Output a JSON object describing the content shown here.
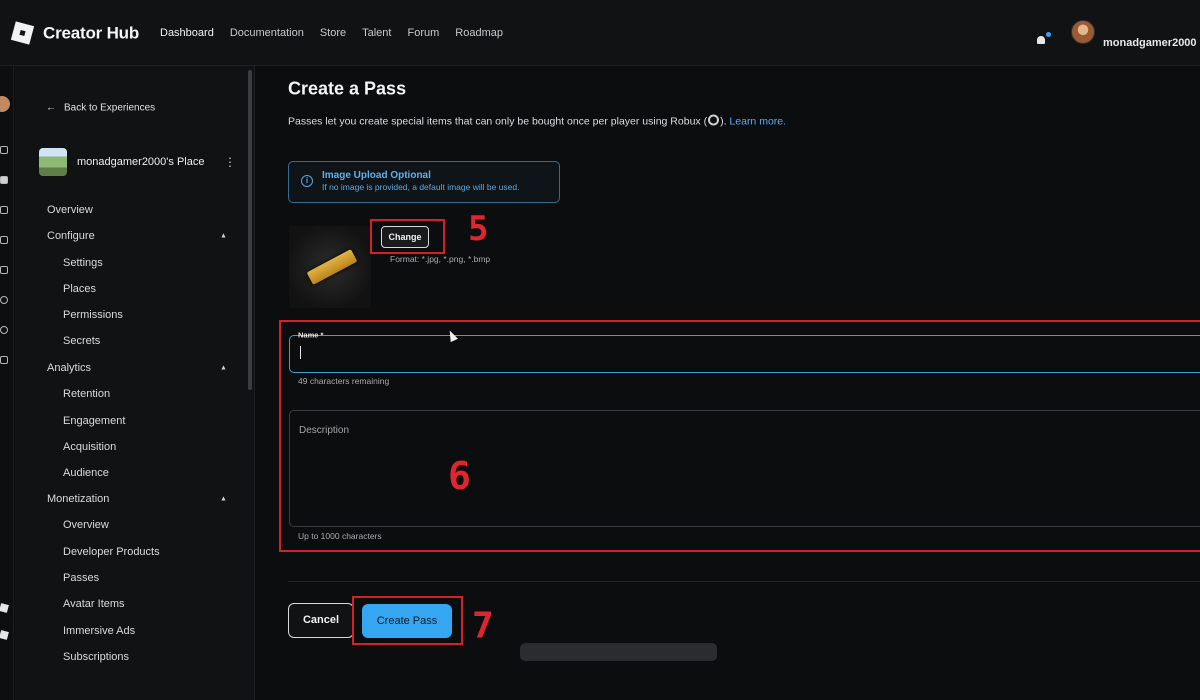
{
  "topbar": {
    "brand": "Creator Hub",
    "nav": [
      "Dashboard",
      "Documentation",
      "Store",
      "Talent",
      "Forum",
      "Roadmap"
    ],
    "username": "monadgamer2000",
    "notification_dot_color": "#3aa0ff"
  },
  "sidebar": {
    "back_label": "Back to Experiences",
    "place_name": "monadgamer2000's Place",
    "items": [
      {
        "label": "Overview",
        "level": "top"
      },
      {
        "label": "Configure",
        "level": "top",
        "expanded": true
      },
      {
        "label": "Settings",
        "level": "sub"
      },
      {
        "label": "Places",
        "level": "sub"
      },
      {
        "label": "Permissions",
        "level": "sub"
      },
      {
        "label": "Secrets",
        "level": "sub"
      },
      {
        "label": "Analytics",
        "level": "top",
        "expanded": true
      },
      {
        "label": "Retention",
        "level": "sub"
      },
      {
        "label": "Engagement",
        "level": "sub"
      },
      {
        "label": "Acquisition",
        "level": "sub"
      },
      {
        "label": "Audience",
        "level": "sub"
      },
      {
        "label": "Monetization",
        "level": "top",
        "expanded": true
      },
      {
        "label": "Overview",
        "level": "sub"
      },
      {
        "label": "Developer Products",
        "level": "sub"
      },
      {
        "label": "Passes",
        "level": "sub"
      },
      {
        "label": "Avatar Items",
        "level": "sub"
      },
      {
        "label": "Immersive Ads",
        "level": "sub"
      },
      {
        "label": "Subscriptions",
        "level": "sub"
      }
    ]
  },
  "main": {
    "title": "Create a Pass",
    "intro_before": "Passes let you create special items that can only be bought once per player using Robux (",
    "intro_after": ").",
    "learn_more": "Learn more.",
    "info_title": "Image Upload Optional",
    "info_text": "If no image is provided, a default image will be used.",
    "change_label": "Change",
    "format_hint": "Format: *.jpg, *.png, *.bmp",
    "name_label": "Name *",
    "name_value": "",
    "name_helper": "49 characters remaining",
    "description_placeholder": "Description",
    "description_helper": "Up to 1000 characters",
    "cancel_label": "Cancel",
    "create_label": "Create Pass",
    "accent_color": "#34a6f2"
  },
  "annotations": [
    "5",
    "6",
    "7"
  ]
}
